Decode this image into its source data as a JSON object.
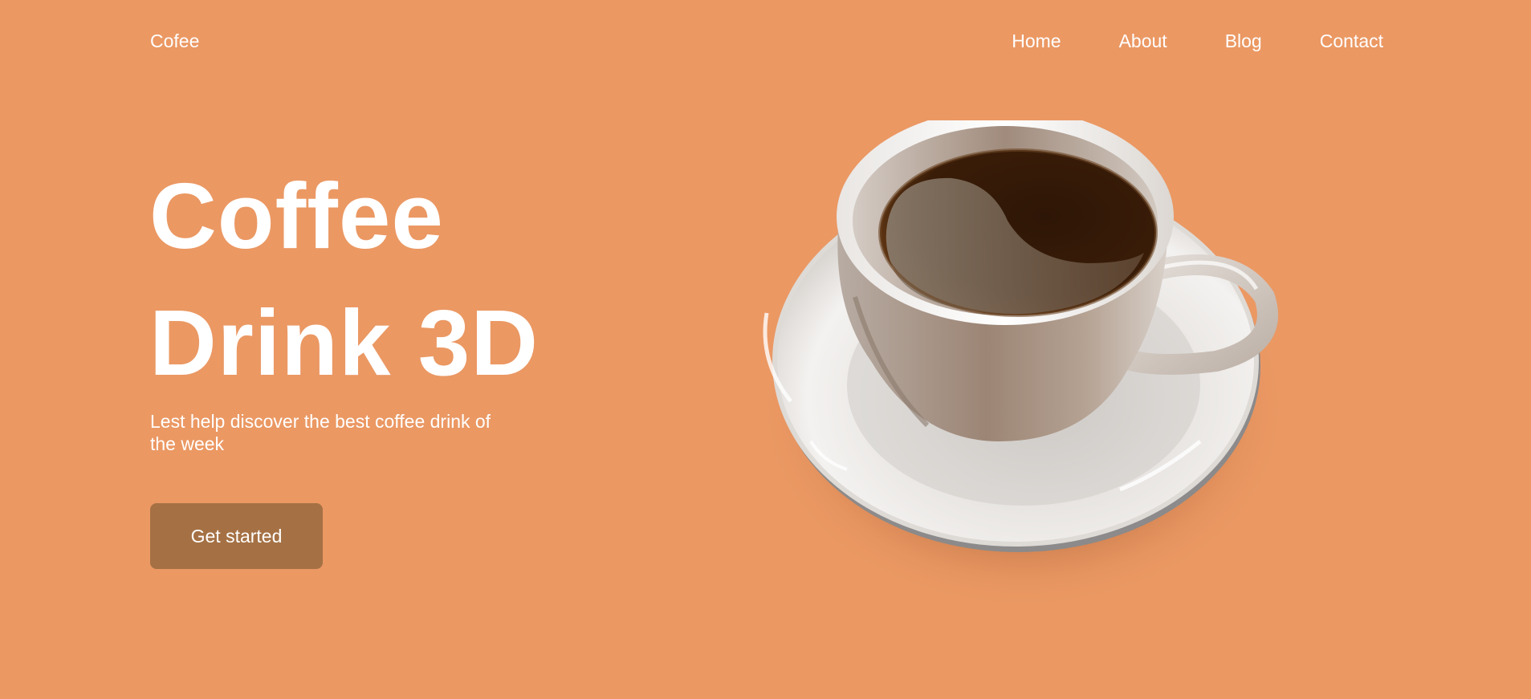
{
  "header": {
    "logo": "Cofee",
    "nav": [
      {
        "label": "Home"
      },
      {
        "label": "About"
      },
      {
        "label": "Blog"
      },
      {
        "label": "Contact"
      }
    ]
  },
  "hero": {
    "title_line1": "Coffee",
    "title_line2": "Drink 3D",
    "tagline": "Lest help discover the best coffee drink of the week",
    "cta_label": "Get started",
    "image": "coffee-cup-saucer-illustration"
  },
  "colors": {
    "background": "#EB9863",
    "button": "#A57144",
    "text": "#FFFFFF"
  }
}
